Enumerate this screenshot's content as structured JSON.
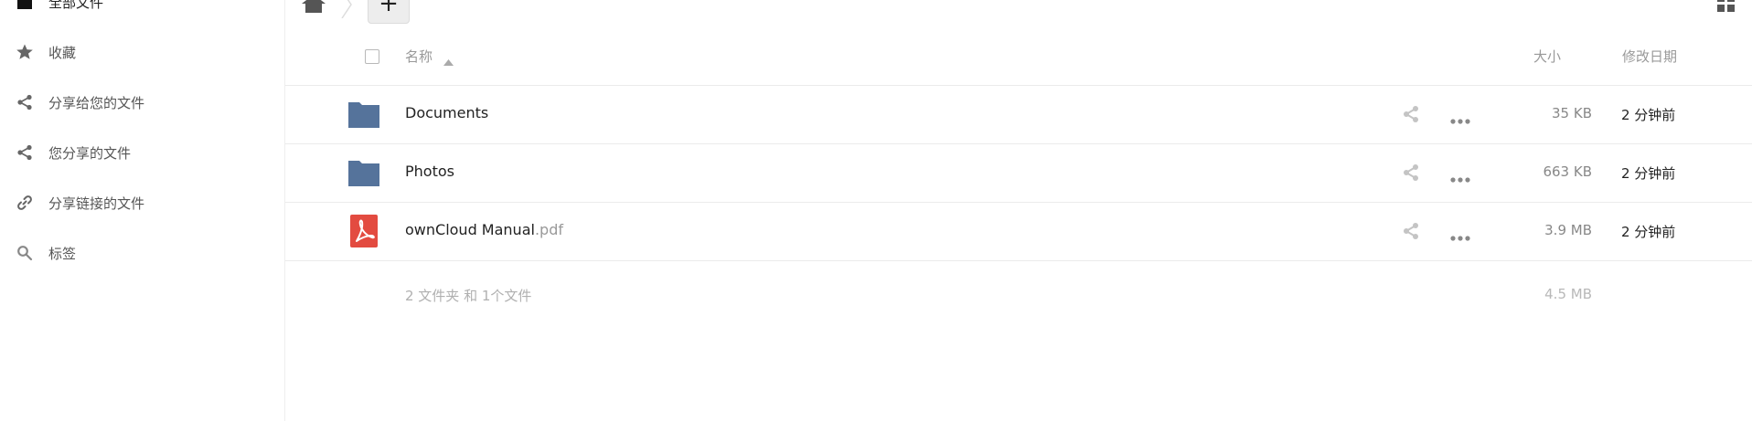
{
  "sidebar": {
    "items": [
      {
        "label": "全部文件",
        "icon": "folder-icon",
        "active": true
      },
      {
        "label": "收藏",
        "icon": "star-icon"
      },
      {
        "label": "分享给您的文件",
        "icon": "share-icon"
      },
      {
        "label": "您分享的文件",
        "icon": "share-icon"
      },
      {
        "label": "分享链接的文件",
        "icon": "link-icon"
      },
      {
        "label": "标签",
        "icon": "search-icon"
      }
    ]
  },
  "header": {
    "new_label": "+",
    "columns": {
      "name": "名称",
      "size": "大小",
      "modified": "修改日期"
    }
  },
  "files": [
    {
      "name": "Documents",
      "ext": "",
      "type": "folder",
      "size": "35 KB",
      "modified": "2 分钟前"
    },
    {
      "name": "Photos",
      "ext": "",
      "type": "folder",
      "size": "663 KB",
      "modified": "2 分钟前"
    },
    {
      "name": "ownCloud Manual",
      "ext": ".pdf",
      "type": "pdf",
      "size": "3.9 MB",
      "modified": "2 分钟前"
    }
  ],
  "summary": {
    "text": "2 文件夹 和 1个文件",
    "size": "4.5 MB"
  },
  "colors": {
    "folder": "#55739b",
    "pdf": "#e34b40",
    "accent": "#1d2d44"
  }
}
